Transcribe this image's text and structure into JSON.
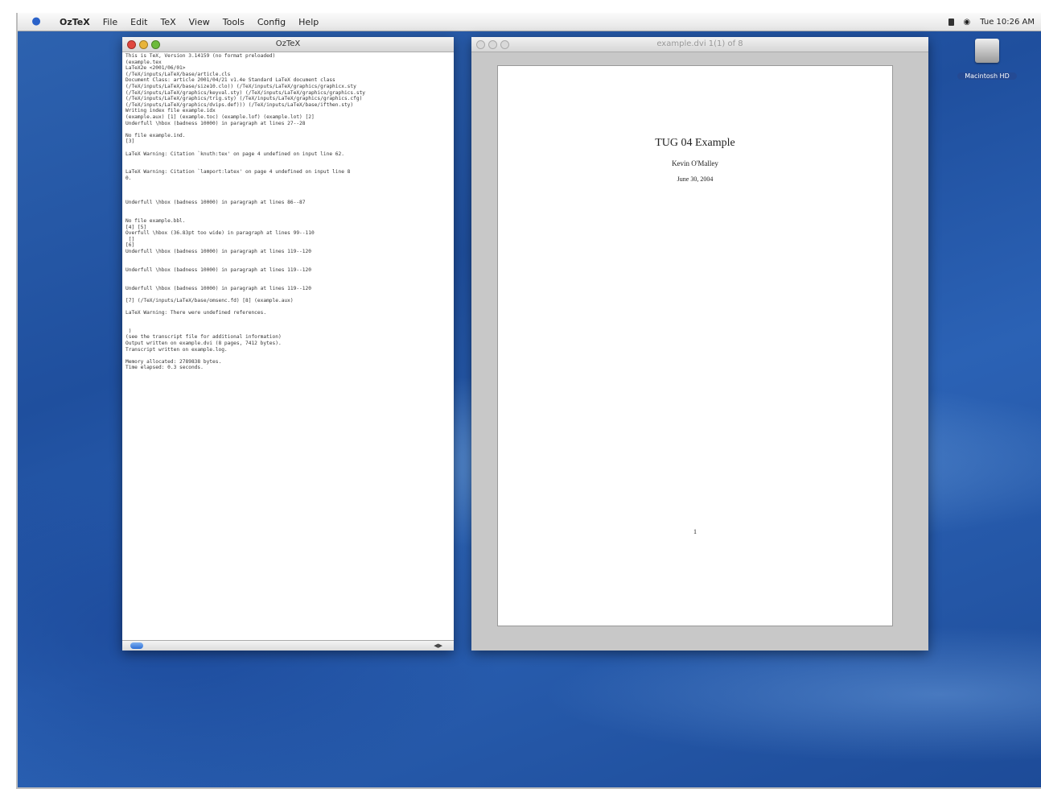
{
  "menubar": {
    "app_name": "OzTeX",
    "items": [
      "File",
      "Edit",
      "TeX",
      "View",
      "Tools",
      "Config",
      "Help"
    ],
    "clock": "Tue 10:26 AM"
  },
  "console_window": {
    "title": "OzTeX",
    "log_lines": [
      "This is TeX, Version 3.14159 (no format preloaded)",
      "(example.tex",
      "LaTeX2e <2001/06/01>",
      "(/TeX/inputs/LaTeX/base/article.cls",
      "Document Class: article 2001/04/21 v1.4e Standard LaTeX document class",
      "(/TeX/inputs/LaTeX/base/size10.clo)) (/TeX/inputs/LaTeX/graphics/graphicx.sty",
      "(/TeX/inputs/LaTeX/graphics/keyval.sty) (/TeX/inputs/LaTeX/graphics/graphics.sty",
      "(/TeX/inputs/LaTeX/graphics/trig.sty) (/TeX/inputs/LaTeX/graphics/graphics.cfg)",
      "(/TeX/inputs/LaTeX/graphics/dvips.def))) (/TeX/inputs/LaTeX/base/ifthen.sty)",
      "Writing index file example.idx",
      "(example.aux) [1] (example.toc) (example.lof) (example.lot) [2]",
      "Underfull \\hbox (badness 10000) in paragraph at lines 27--28",
      "",
      "No file example.ind.",
      "[3]",
      "",
      "LaTeX Warning: Citation `knuth:tex' on page 4 undefined on input line 62.",
      "",
      "",
      "LaTeX Warning: Citation `lamport:latex' on page 4 undefined on input line 8",
      "0.",
      "",
      "",
      "",
      "Underfull \\hbox (badness 10000) in paragraph at lines 86--87",
      "",
      "",
      "No file example.bbl.",
      "[4] [5]",
      "Overfull \\hbox (36.83pt too wide) in paragraph at lines 99--110",
      " []",
      "[6]",
      "Underfull \\hbox (badness 10000) in paragraph at lines 119--120",
      "",
      "",
      "Underfull \\hbox (badness 10000) in paragraph at lines 119--120",
      "",
      "",
      "Underfull \\hbox (badness 10000) in paragraph at lines 119--120",
      "",
      "[7] (/TeX/inputs/LaTeX/base/omsenc.fd) [8] (example.aux)",
      "",
      "LaTeX Warning: There were undefined references.",
      "",
      "",
      " )",
      "(see the transcript file for additional information)",
      "Output written on example.dvi (8 pages, 7412 bytes).",
      "Transcript written on example.log.",
      "",
      "Memory allocated: 2789838 bytes.",
      "Time elapsed: 0.3 seconds."
    ]
  },
  "preview_window": {
    "title": "example.dvi  1(1) of 8",
    "doc_title": "TUG 04 Example",
    "doc_author": "Kevin O'Malley",
    "doc_date": "June 30, 2004",
    "page_number": "1"
  },
  "desktop": {
    "hd_label": "Macintosh HD"
  }
}
